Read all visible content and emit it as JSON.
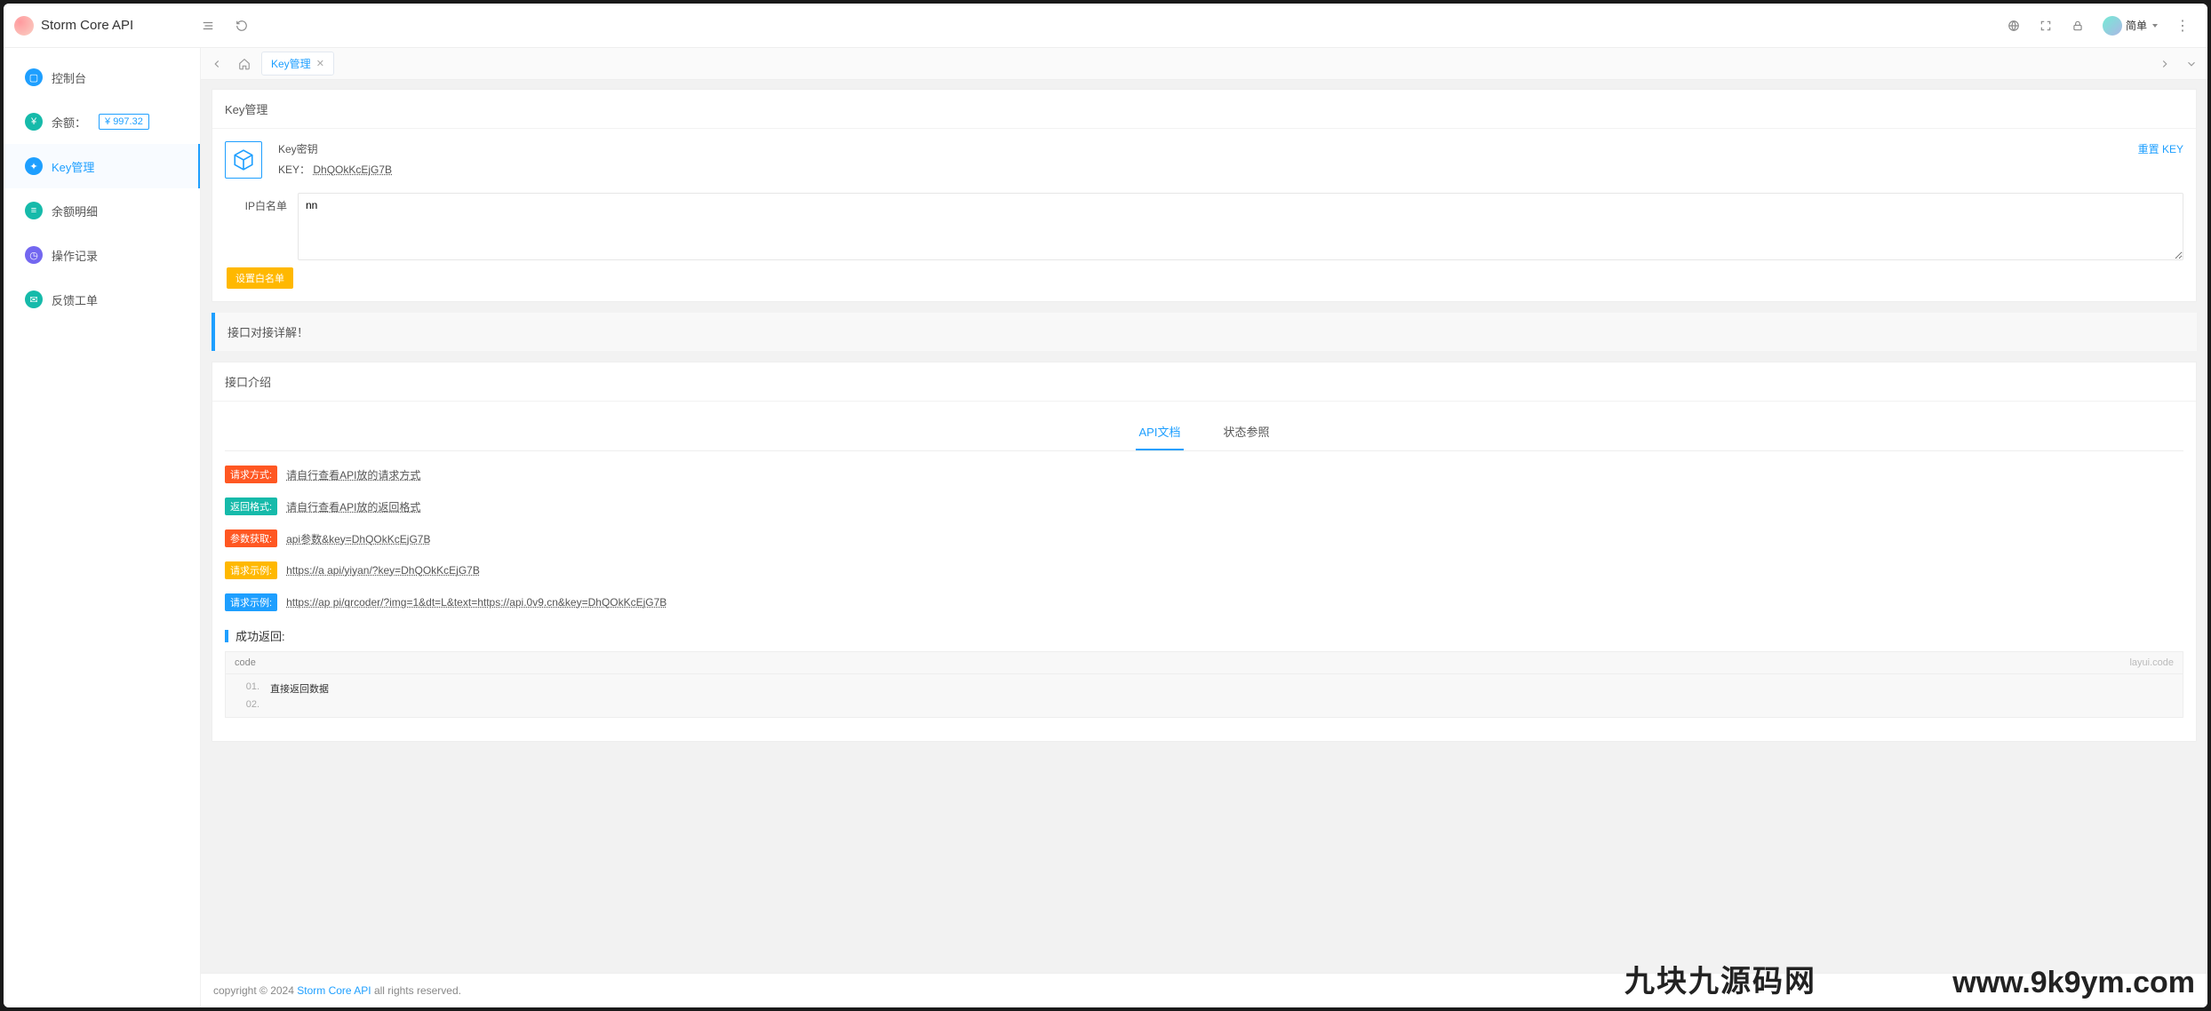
{
  "brand": "Storm Core API",
  "header": {
    "user_name": "简单"
  },
  "sidebar": {
    "items": [
      {
        "label": "控制台",
        "icon_bg": "#1e9fff"
      },
      {
        "label": "余额：",
        "balance": "¥ 997.32",
        "icon_bg": "#16baaa"
      },
      {
        "label": "Key管理",
        "icon_bg": "#1e9fff"
      },
      {
        "label": "余额明细",
        "icon_bg": "#16baaa"
      },
      {
        "label": "操作记录",
        "icon_bg": "#7367f0"
      },
      {
        "label": "反馈工单",
        "icon_bg": "#16baaa"
      }
    ]
  },
  "tabbar": {
    "active_tab": "Key管理"
  },
  "page": {
    "title": "Key管理",
    "key_section": {
      "title": "Key密钥",
      "key_label": "KEY：",
      "key_value": "DhQOkKcEjG7B",
      "reset_label": "重置 KEY"
    },
    "ip_whitelist": {
      "label": "IP白名单",
      "value": "nn",
      "set_button": "设置白名单"
    },
    "docs_banner": "接口对接详解！",
    "intro_title": "接口介绍",
    "inner_tabs": {
      "api_doc": "API文档",
      "status": "状态参照"
    },
    "rows": [
      {
        "tag": "请求方式:",
        "tag_color": "#ff5722",
        "text": "请自行查看API放的请求方式"
      },
      {
        "tag": "返回格式:",
        "tag_color": "#16baaa",
        "text": "请自行查看API放的返回格式"
      },
      {
        "tag": "参数获取:",
        "tag_color": "#ff5722",
        "text": "api参数&key=DhQOkKcEjG7B"
      },
      {
        "tag": "请求示例:",
        "tag_color": "#ffb800",
        "text": "https://a            api/yiyan/?key=DhQOkKcEjG7B"
      },
      {
        "tag": "请求示例:",
        "tag_color": "#1e9fff",
        "text": "https://ap          pi/qrcoder/?img=1&dt=L&text=https://api.0v9.cn&key=DhQOkKcEjG7B"
      }
    ],
    "return_title": "成功返回:",
    "code": {
      "name": "code",
      "type": "layui.code",
      "lines": [
        "直接返回数据",
        ""
      ]
    }
  },
  "footer": {
    "prefix": "copyright © 2024 ",
    "link": "Storm Core API",
    "suffix": " all rights reserved."
  },
  "watermark": {
    "cn": "九块九源码网",
    "url": "www.9k9ym.com"
  }
}
